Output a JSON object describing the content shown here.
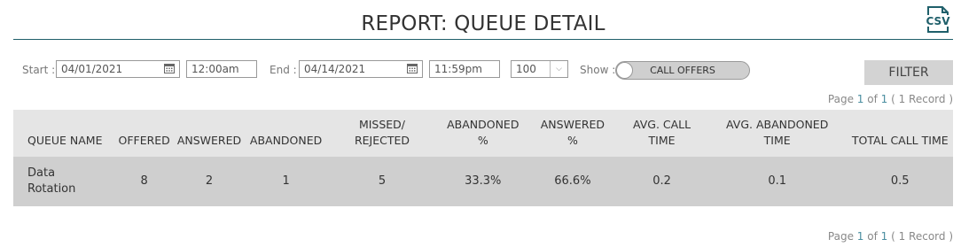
{
  "title": "REPORT: QUEUE DETAIL",
  "csv_label": "CSV",
  "filters": {
    "start_label": "Start :",
    "start_date": "04/01/2021",
    "start_time": "12:00am",
    "end_label": "End :",
    "end_date": "04/14/2021",
    "end_time": "11:59pm",
    "page_size": "100",
    "show_label": "Show :",
    "toggle_label": "CALL OFFERS",
    "filter_button": "FILTER"
  },
  "pager_top": {
    "prefix": "Page ",
    "current": "1",
    "of": " of ",
    "total": "1",
    "records": " ( 1 Record )"
  },
  "pager_bottom": {
    "prefix": "Page ",
    "current": "1",
    "of": " of ",
    "total": "1",
    "records": " ( 1 Record )"
  },
  "table": {
    "headers": [
      [
        "QUEUE NAME"
      ],
      [
        "OFFERED"
      ],
      [
        "ANSWERED"
      ],
      [
        "ABANDONED"
      ],
      [
        "MISSED/",
        "REJECTED"
      ],
      [
        "ABANDONED",
        "%"
      ],
      [
        "ANSWERED",
        "%"
      ],
      [
        "AVG. CALL",
        "TIME"
      ],
      [
        "AVG. ABANDONED",
        "TIME"
      ],
      [
        "TOTAL CALL TIME"
      ]
    ],
    "rows": [
      [
        "Data Rotation",
        "8",
        "2",
        "1",
        "5",
        "33.3%",
        "66.6%",
        "0.2",
        "0.1",
        "0.5"
      ]
    ]
  },
  "colors": {
    "accent": "#1f5f6a",
    "link": "#4a8ea0",
    "header_bg": "#e5e5e5",
    "row_bg": "#cfcfcf"
  }
}
